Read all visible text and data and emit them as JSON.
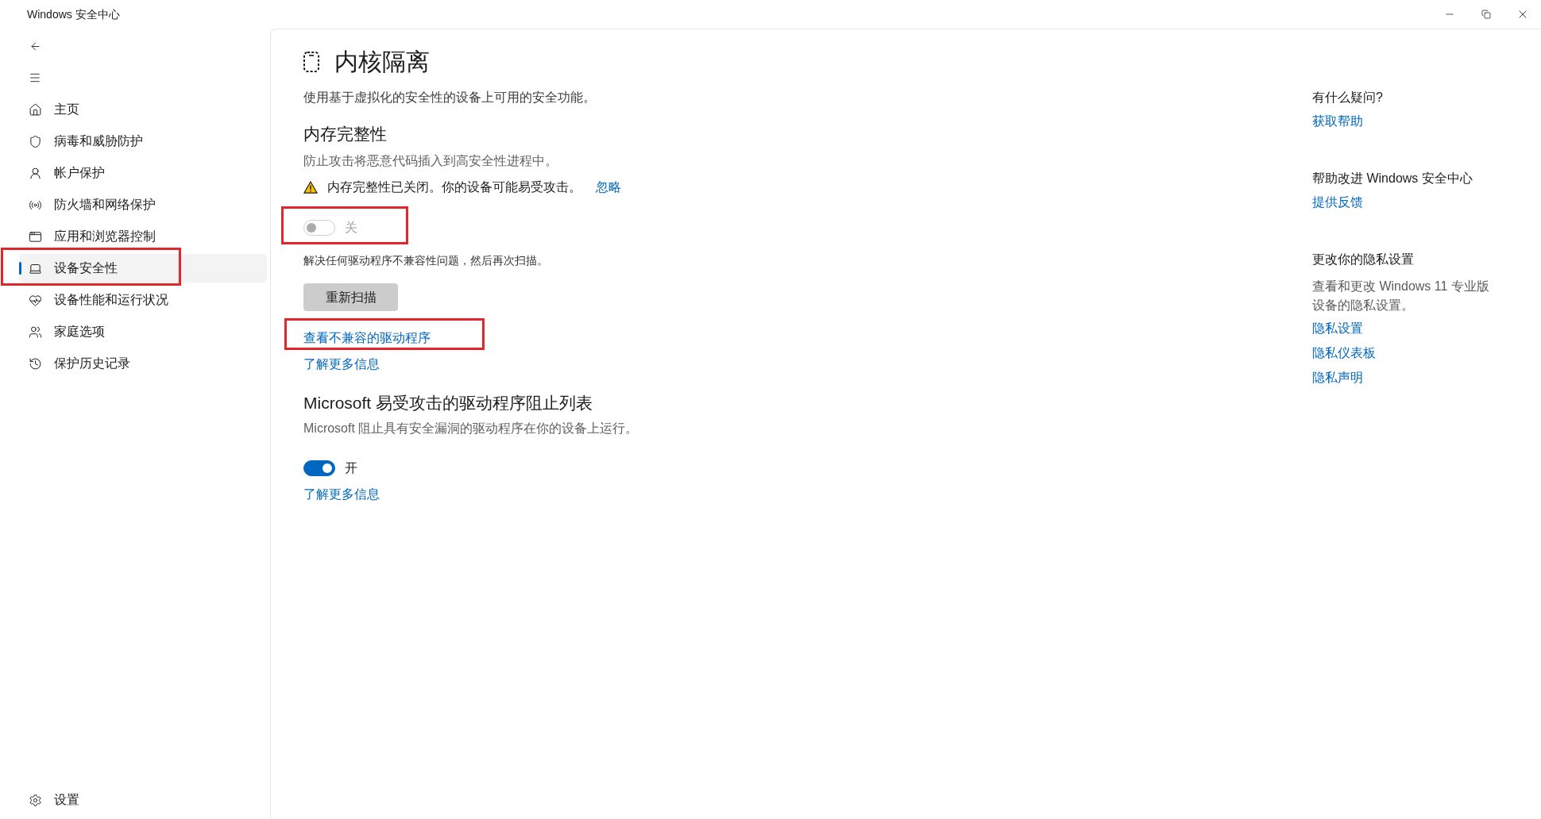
{
  "window": {
    "title": "Windows 安全中心"
  },
  "sidebar": {
    "items": [
      {
        "label": "主页",
        "selected": false,
        "highlighted": false
      },
      {
        "label": "病毒和威胁防护",
        "selected": false,
        "highlighted": false
      },
      {
        "label": "帐户保护",
        "selected": false,
        "highlighted": false
      },
      {
        "label": "防火墙和网络保护",
        "selected": false,
        "highlighted": false
      },
      {
        "label": "应用和浏览器控制",
        "selected": false,
        "highlighted": false
      },
      {
        "label": "设备安全性",
        "selected": true,
        "highlighted": true
      },
      {
        "label": "设备性能和运行状况",
        "selected": false,
        "highlighted": false
      },
      {
        "label": "家庭选项",
        "selected": false,
        "highlighted": false
      },
      {
        "label": "保护历史记录",
        "selected": false,
        "highlighted": false
      }
    ],
    "footer_item": {
      "label": "设置",
      "selected": false
    }
  },
  "page": {
    "title": "内核隔离",
    "subtitle": "使用基于虚拟化的安全性的设备上可用的安全功能。"
  },
  "sections": [
    {
      "heading": "内存完整性",
      "description": "防止攻击将恶意代码插入到高安全性进程中。",
      "warning": {
        "text": "内存完整性已关闭。你的设备可能易受攻击。",
        "link": "忽略"
      },
      "toggle": {
        "label": "关",
        "on": false,
        "disabled": true,
        "highlighted": true
      },
      "note": "解决任何驱动程序不兼容性问题，然后再次扫描。",
      "button": "重新扫描",
      "links": [
        {
          "label": "查看不兼容的驱动程序",
          "highlighted": true
        },
        {
          "label": "了解更多信息",
          "highlighted": false
        }
      ]
    },
    {
      "heading": "Microsoft 易受攻击的驱动程序阻止列表",
      "description": "Microsoft 阻止具有安全漏洞的驱动程序在你的设备上运行。",
      "toggle": {
        "label": "开",
        "on": true,
        "disabled": false,
        "highlighted": false
      },
      "links": [
        {
          "label": "了解更多信息",
          "highlighted": false
        }
      ]
    }
  ],
  "side_panel": {
    "groups": [
      {
        "heading": "有什么疑问?",
        "links": [
          "获取帮助"
        ]
      },
      {
        "heading": "帮助改进 Windows 安全中心",
        "links": [
          "提供反馈"
        ]
      },
      {
        "heading": "更改你的隐私设置",
        "description": "查看和更改 Windows 11 专业版设备的隐私设置。",
        "links": [
          "隐私设置",
          "隐私仪表板",
          "隐私声明"
        ]
      }
    ]
  }
}
